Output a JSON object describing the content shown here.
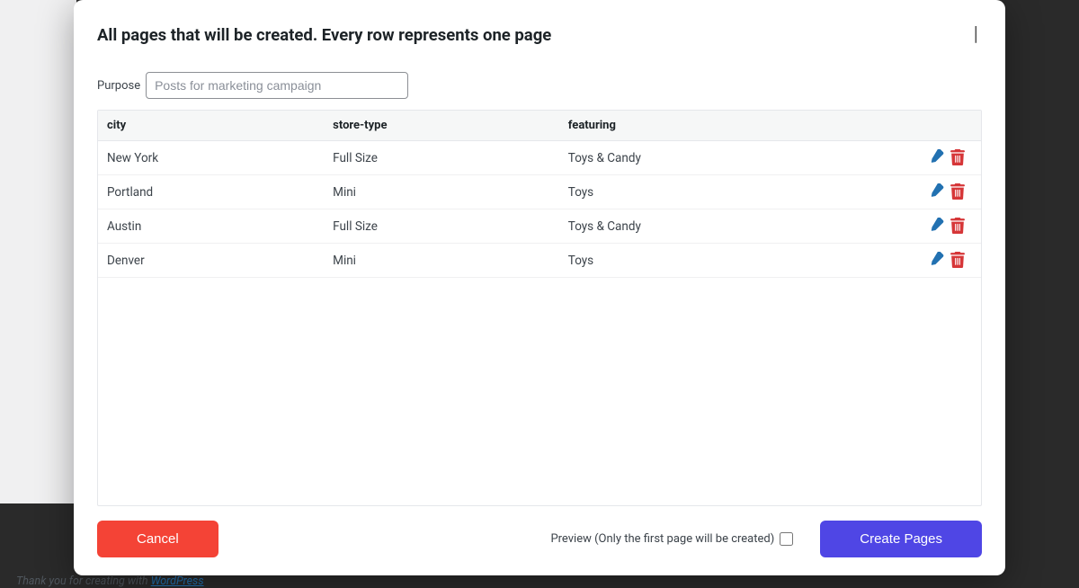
{
  "modal": {
    "title": "All pages that will be created. Every row represents one page",
    "close_label": "|"
  },
  "purpose": {
    "label": "Purpose",
    "placeholder": "Posts for marketing campaign",
    "value": ""
  },
  "table": {
    "headers": [
      "city",
      "store-type",
      "featuring"
    ],
    "rows": [
      {
        "city": "New York",
        "store_type": "Full Size",
        "featuring": "Toys & Candy"
      },
      {
        "city": "Portland",
        "store_type": "Mini",
        "featuring": "Toys"
      },
      {
        "city": "Austin",
        "store_type": "Full Size",
        "featuring": "Toys & Candy"
      },
      {
        "city": "Denver",
        "store_type": "Mini",
        "featuring": "Toys"
      }
    ]
  },
  "footer": {
    "cancel": "Cancel",
    "preview_label": "Preview (Only the first page will be created)",
    "create": "Create Pages"
  },
  "wp_footer": {
    "prefix": "Thank you for creating with ",
    "link": "WordPress"
  },
  "colors": {
    "edit_icon": "#2271b1",
    "delete_icon": "#d63638",
    "cancel_btn": "#f44336",
    "primary_btn": "#4f46e5"
  }
}
